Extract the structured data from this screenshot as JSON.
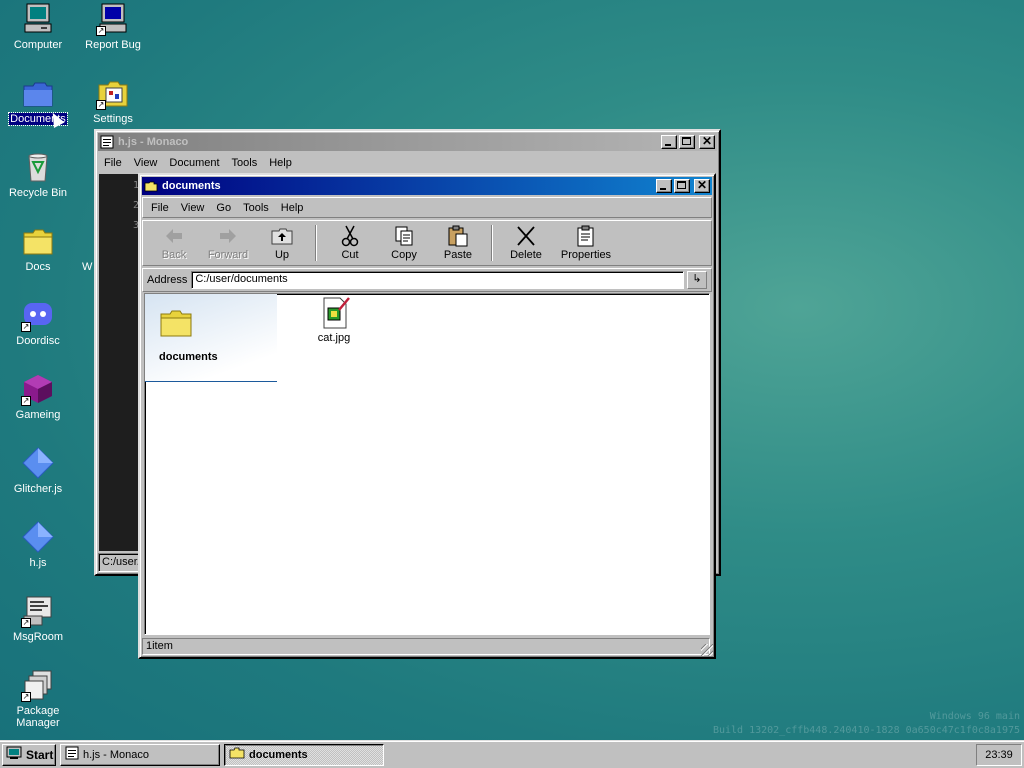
{
  "desktop": {
    "icons": [
      {
        "label": "Computer",
        "icon": "computer-icon"
      },
      {
        "label": "Report Bug",
        "icon": "report-bug-icon"
      },
      {
        "label": "Documents",
        "icon": "documents-folder-icon"
      },
      {
        "label": "Settings",
        "icon": "settings-icon"
      },
      {
        "label": "Recycle Bin",
        "icon": "recycle-bin-icon"
      },
      {
        "label": "Docs",
        "icon": "folder-icon"
      },
      {
        "label": "Doordisc",
        "icon": "doordisc-icon"
      },
      {
        "label": "Gameing",
        "icon": "gameing-icon"
      },
      {
        "label": "Glitcher.js",
        "icon": "glitcher-icon"
      },
      {
        "label": "h.js",
        "icon": "hjs-icon"
      },
      {
        "label": "MsgRoom",
        "icon": "msgroom-icon"
      },
      {
        "label": "Package Manager",
        "icon": "package-manager-icon"
      }
    ],
    "partial_label": "W",
    "watermark_line1": "Windows 96 main",
    "watermark_line2": "Build 13202_cffb448.240410-1828 0a650c47c1f0c8a1975"
  },
  "monaco_window": {
    "title": "h.js - Monaco",
    "menu": [
      "File",
      "View",
      "Document",
      "Tools",
      "Help"
    ],
    "line_numbers": [
      "1",
      "2",
      "3"
    ],
    "status_text": "C:/user/"
  },
  "explorer_window": {
    "title": "documents",
    "menu": [
      "File",
      "View",
      "Go",
      "Tools",
      "Help"
    ],
    "toolbar": {
      "back": "Back",
      "forward": "Forward",
      "up": "Up",
      "cut": "Cut",
      "copy": "Copy",
      "paste": "Paste",
      "delete": "Delete",
      "properties": "Properties"
    },
    "address_label": "Address",
    "address_value": "C:/user/documents",
    "folder_title": "documents",
    "files": [
      {
        "name": "cat.jpg",
        "icon": "image-file-icon"
      }
    ],
    "status": "1item"
  },
  "taskbar": {
    "start_label": "Start",
    "items": [
      {
        "label": "h.js - Monaco",
        "active": false
      },
      {
        "label": "documents",
        "active": true
      }
    ],
    "clock": "23:39"
  },
  "colors": {
    "desktop": "#1f7a7e",
    "active_title": "#000080",
    "inactive_title": "#808080",
    "window_face": "#c0c0c0"
  }
}
